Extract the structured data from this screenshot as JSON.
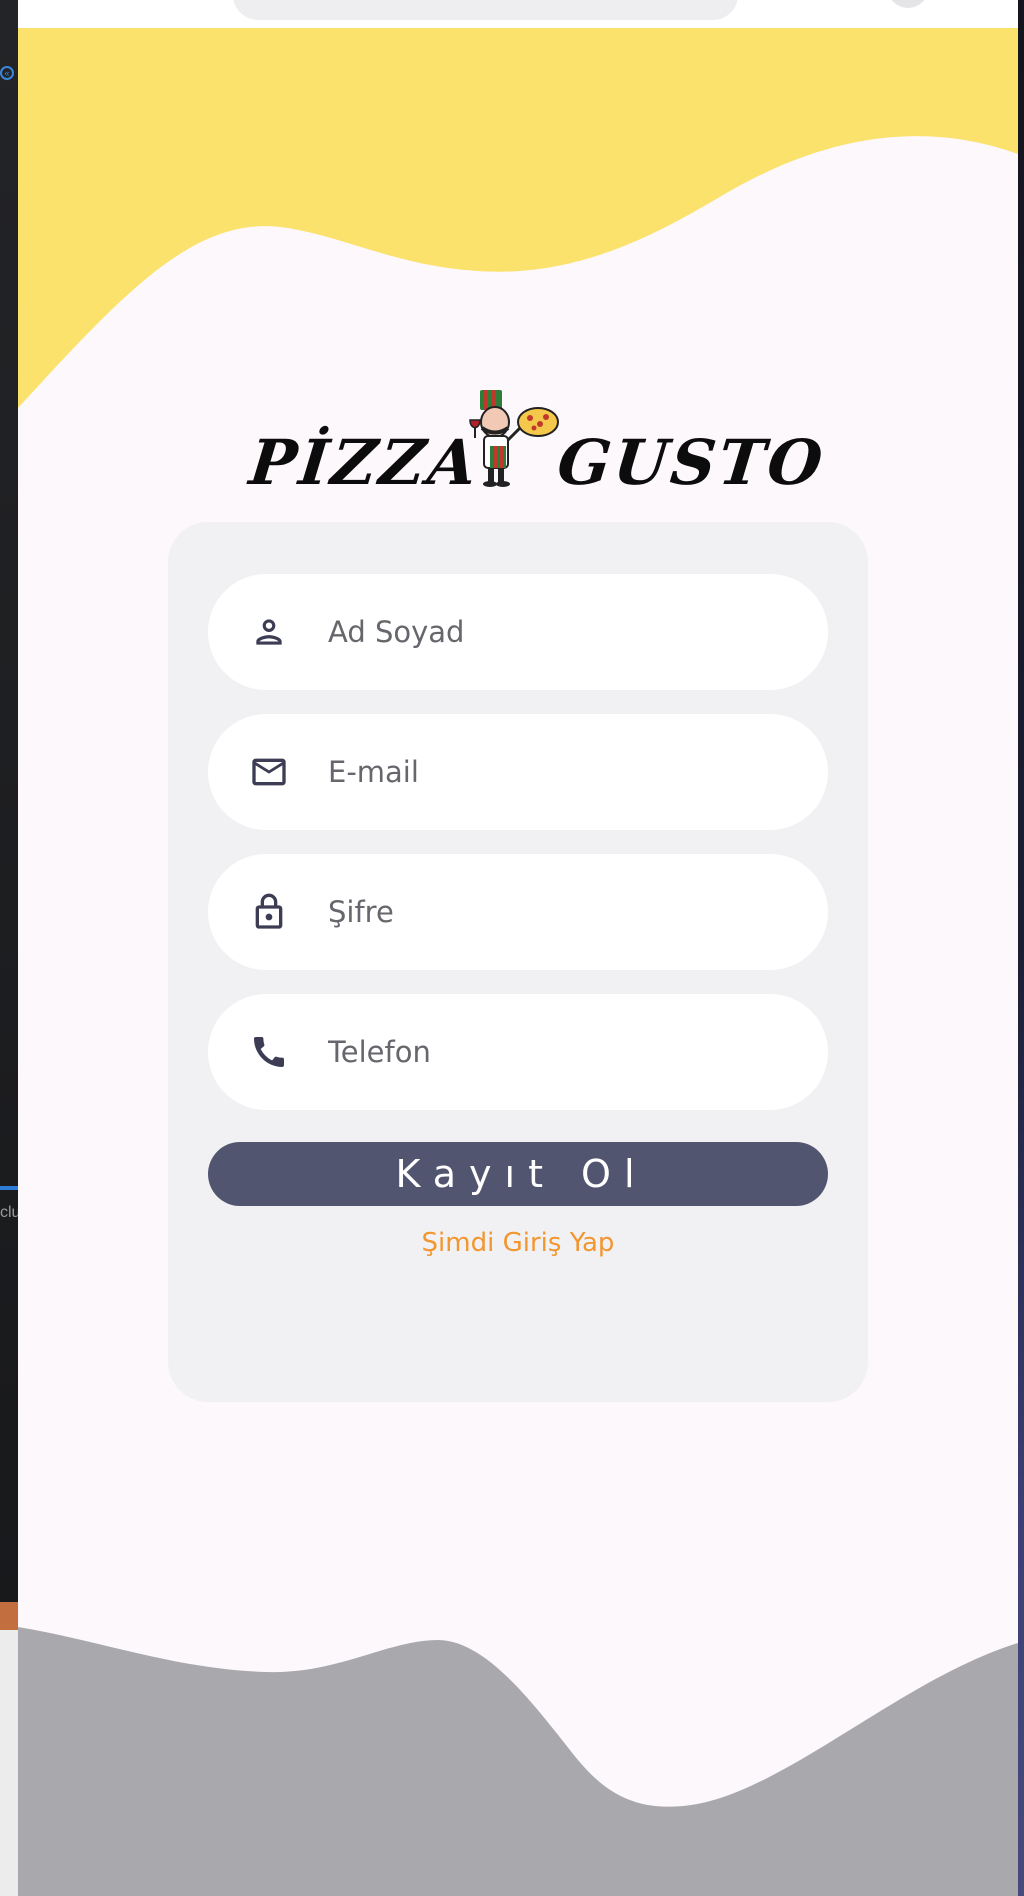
{
  "app": {
    "brand_left": "PİZZA",
    "brand_right": "GUSTO"
  },
  "form": {
    "name_placeholder": "Ad Soyad",
    "email_placeholder": "E-mail",
    "password_placeholder": "Şifre",
    "phone_placeholder": "Telefon",
    "submit_label": "Kayıt Ol",
    "login_link": "Şimdi Giriş Yap"
  },
  "icons": {
    "name": "person-icon",
    "email": "mail-icon",
    "password": "lock-icon",
    "phone": "phone-icon"
  },
  "colors": {
    "background": "#fdf8fc",
    "top_wave": "#fae26c",
    "bottom_wave": "#a9a9ad",
    "card": "#f1f1f3",
    "field": "#ffffff",
    "icon": "#3c3d55",
    "button": "#515570",
    "link": "#f2962f"
  }
}
